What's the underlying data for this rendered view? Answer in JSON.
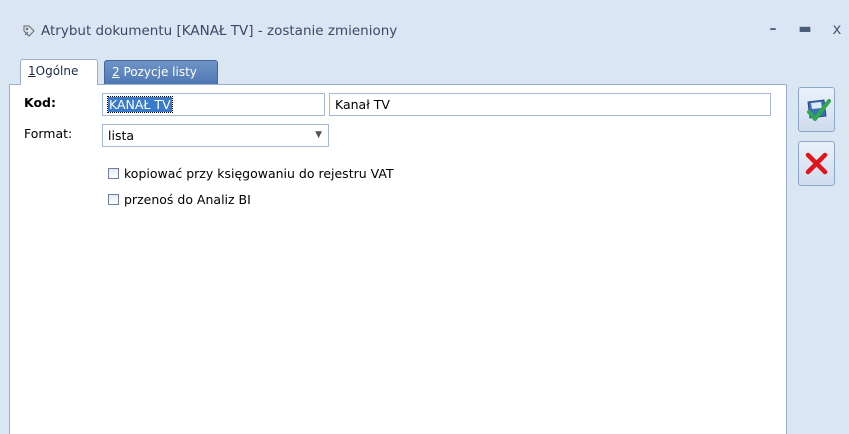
{
  "window": {
    "title": "Atrybut dokumentu [KANAŁ TV] - zostanie zmieniony",
    "minimize": "–",
    "maximize": "▬",
    "close": "x"
  },
  "tabs": [
    {
      "number": "1",
      "label": "Ogólne",
      "active": true
    },
    {
      "number": "2",
      "label": "Pozycje listy",
      "active": false
    }
  ],
  "form": {
    "kod_label": "Kod:",
    "kod_value": "KANAŁ TV",
    "name_value": "Kanał TV",
    "format_label": "Format:",
    "format_value": "lista",
    "checkbox1_label": "kopiować przy księgowaniu do rejestru VAT",
    "checkbox1_checked": false,
    "checkbox2_label": "przenoś do Analiz BI",
    "checkbox2_checked": false
  },
  "actions": {
    "save_icon": "save-check-icon",
    "cancel_icon": "red-x-icon"
  },
  "colors": {
    "accent_blue": "#4f78b4",
    "save_check": "#2fa84f",
    "cancel_red": "#e0141c",
    "selection": "#3b7ac9"
  }
}
